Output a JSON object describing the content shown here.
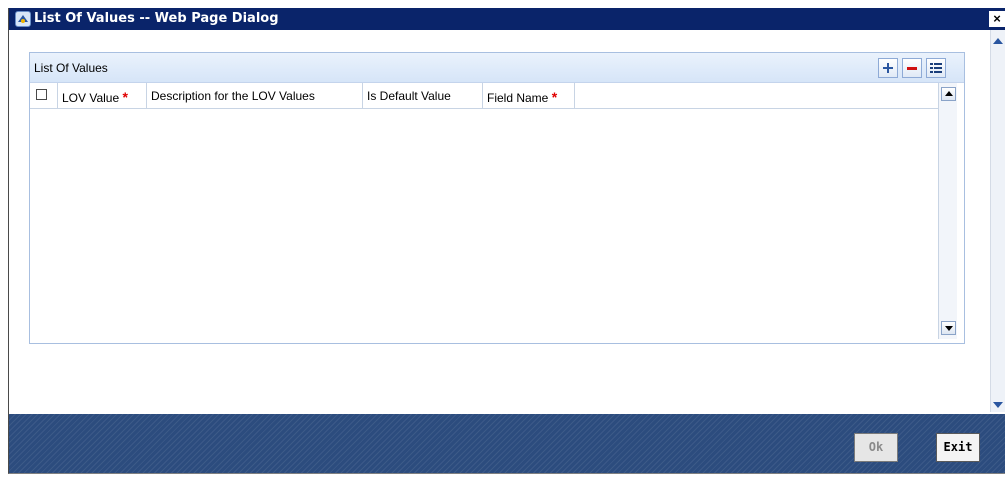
{
  "window": {
    "title": "List Of Values -- Web Page Dialog",
    "close_label": "×"
  },
  "panel": {
    "title": "List Of Values",
    "tools": [
      "add-icon",
      "remove-icon",
      "single-view-icon"
    ]
  },
  "grid": {
    "columns": [
      {
        "label": "LOV Value",
        "required": true
      },
      {
        "label": "Description for the LOV Values",
        "required": false
      },
      {
        "label": "Is Default Value",
        "required": false
      },
      {
        "label": "Field Name",
        "required": true
      }
    ],
    "required_marker": "*",
    "rows": []
  },
  "footer": {
    "ok_label": "Ok",
    "exit_label": "Exit",
    "ok_enabled": false
  },
  "colors": {
    "title_bar": "#0a246a",
    "footer": "#2c4c7e",
    "required": "#e00000",
    "accent": "#2a56a0"
  }
}
